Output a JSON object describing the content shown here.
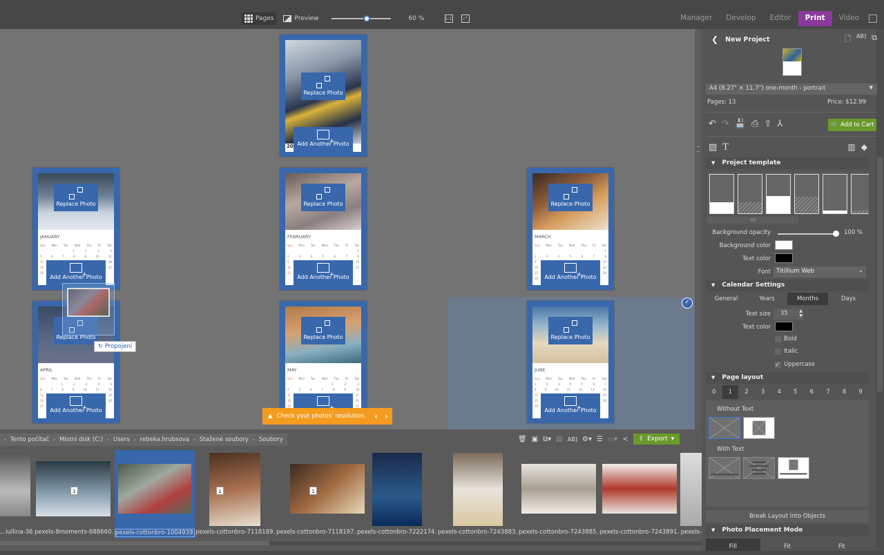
{
  "toolbar": {
    "pages_label": "Pages",
    "preview_label": "Preview",
    "zoom_percent": "60 %",
    "zoom_value": 0.6,
    "one_to_one_label": "1:1"
  },
  "modes": [
    {
      "label": "Manager",
      "active": false
    },
    {
      "label": "Develop",
      "active": false
    },
    {
      "label": "Editor",
      "active": false
    },
    {
      "label": "Print",
      "active": true
    },
    {
      "label": "Video",
      "active": false
    }
  ],
  "canvas": {
    "replace_label": "Replace Photo",
    "add_label": "Add Another Photo",
    "cover_year_fragment": "20",
    "weekdays": [
      "Sun",
      "Mon",
      "Tue",
      "Wed",
      "Thu",
      "Fri",
      "Sat"
    ],
    "months": [
      {
        "name": "JANUARY",
        "rows": [
          [
            "",
            "",
            "",
            "1",
            "2",
            "3",
            "4"
          ],
          [
            "5",
            "6",
            "7",
            "8",
            "9",
            "10",
            "11"
          ],
          [
            "12",
            "",
            "",
            "",
            "",
            "",
            "18"
          ],
          [
            "19",
            "",
            "",
            "",
            "",
            "",
            "25"
          ],
          [
            "26",
            "",
            "",
            "",
            "",
            "",
            ""
          ]
        ]
      },
      {
        "name": "FEBRUARY",
        "rows": [
          [
            "",
            "",
            "",
            "",
            "",
            "",
            "1"
          ],
          [
            "2",
            "3",
            "4",
            "5",
            "6",
            "7",
            "8"
          ],
          [
            "9",
            "",
            "",
            "",
            "",
            "",
            "15"
          ],
          [
            "16",
            "",
            "",
            "",
            "",
            "",
            "22"
          ],
          [
            "23",
            "",
            "",
            "",
            "",
            "",
            ""
          ]
        ]
      },
      {
        "name": "MARCH",
        "rows": [
          [
            "",
            "",
            "",
            "",
            "",
            "",
            "1"
          ],
          [
            "2",
            "3",
            "4",
            "5",
            "6",
            "7",
            "8"
          ],
          [
            "9",
            "",
            "",
            "",
            "",
            "",
            "15"
          ],
          [
            "16",
            "",
            "",
            "",
            "",
            "",
            "22"
          ],
          [
            "23",
            "",
            "",
            "",
            "",
            "",
            "29"
          ],
          [
            "30",
            "",
            "",
            "",
            "",
            "",
            ""
          ]
        ]
      },
      {
        "name": "APRIL",
        "rows": [
          [
            "",
            "",
            "1",
            "2",
            "3",
            "4",
            "5"
          ],
          [
            "6",
            "7",
            "8",
            "9",
            "10",
            "11",
            "12"
          ],
          [
            "13",
            "",
            "",
            "",
            "",
            "",
            "19"
          ],
          [
            "20",
            "",
            "",
            "",
            "",
            "",
            "26"
          ],
          [
            "27",
            "",
            "",
            "",
            "",
            "",
            ""
          ]
        ]
      },
      {
        "name": "MAY",
        "rows": [
          [
            "",
            "",
            "",
            "",
            "1",
            "2",
            "3"
          ],
          [
            "4",
            "5",
            "6",
            "7",
            "8",
            "9",
            "10"
          ],
          [
            "11",
            "",
            "",
            "",
            "",
            "",
            "17"
          ],
          [
            "18",
            "",
            "",
            "",
            "",
            "",
            "24"
          ],
          [
            "25",
            "",
            "",
            "",
            "",
            "",
            "31"
          ]
        ]
      },
      {
        "name": "JUNE",
        "rows": [
          [
            "1",
            "2",
            "3",
            "4",
            "5",
            "6",
            "7"
          ],
          [
            "8",
            "9",
            "10",
            "11",
            "12",
            "13",
            "14"
          ],
          [
            "15",
            "",
            "",
            "",
            "",
            "",
            "21"
          ],
          [
            "22",
            "",
            "",
            "",
            "",
            "",
            "28"
          ],
          [
            "29",
            "",
            "",
            "",
            "",
            "",
            ""
          ]
        ]
      }
    ],
    "tooltip": "Propojení",
    "warning": "Check your photos' resolution."
  },
  "breadcrumb": [
    "Tento počítač",
    "Místní disk (C:)",
    "Users",
    "rebeka.hrubsova",
    "Stažené soubory",
    "Soubory"
  ],
  "filmstrip": {
    "export_label": "Export",
    "items": [
      {
        "name": "...iullina-36...",
        "badge": null,
        "selected": false
      },
      {
        "name": "pexels-8moments-688660...",
        "badge": "1",
        "selected": false
      },
      {
        "name": "pexels-cottonbro-1004939...",
        "badge": null,
        "selected": true
      },
      {
        "name": "pexels-cottonbro-7118189...",
        "badge": "1",
        "selected": false
      },
      {
        "name": "pexels-cottonbro-7118197...",
        "badge": "1",
        "selected": false
      },
      {
        "name": "pexels-cottonbro-7222174...",
        "badge": null,
        "selected": false
      },
      {
        "name": "pexels-cottonbro-7243883...",
        "badge": null,
        "selected": false
      },
      {
        "name": "pexels-cottonbro-7243885...",
        "badge": null,
        "selected": false
      },
      {
        "name": "pexels-cottonbro-7243891...",
        "badge": null,
        "selected": false
      },
      {
        "name": "pexels-...",
        "badge": null,
        "selected": false
      }
    ]
  },
  "panel": {
    "title": "New Project",
    "format": "A4 (8.27\" × 11.7\") one-month - portrait",
    "pages": "Pages: 13",
    "price": "Price: $12.99",
    "add_to_cart": "Add to Cart",
    "project_template": {
      "title": "Project template",
      "bg_opacity_label": "Background opacity",
      "bg_opacity_value": "100 %",
      "bg_opacity": 1.0,
      "bg_color_label": "Background color",
      "bg_color": "#ffffff",
      "text_color_label": "Text color",
      "text_color": "#000000",
      "font_label": "Font",
      "font_value": "Titillium Web"
    },
    "calendar_settings": {
      "title": "Calendar Settings",
      "tabs": [
        "General",
        "Years",
        "Months",
        "Days"
      ],
      "active_tab": "Months",
      "text_size_label": "Text size",
      "text_size": "35",
      "text_color_label": "Text color",
      "text_color": "#000000",
      "bold_label": "Bold",
      "bold": false,
      "italic_label": "Italic",
      "italic": false,
      "uppercase_label": "Uppercase",
      "uppercase": true
    },
    "page_layout": {
      "title": "Page layout",
      "numbers": [
        "0",
        "1",
        "2",
        "3",
        "4",
        "5",
        "6",
        "7",
        "8",
        "9"
      ],
      "active": "1",
      "without_text_label": "Without Text",
      "with_text_label": "With Text"
    },
    "break_layout_label": "Break Layout Into Objects",
    "placement": {
      "title": "Photo Placement Mode",
      "options": [
        "Fill",
        "Fit",
        "Fit"
      ],
      "active": "Fill"
    }
  },
  "colors": {
    "accent_print": "#8b3a9b",
    "page_blue": "#3867ac",
    "cart_green": "#6a9a2c",
    "warning_orange": "#f39c1f"
  }
}
